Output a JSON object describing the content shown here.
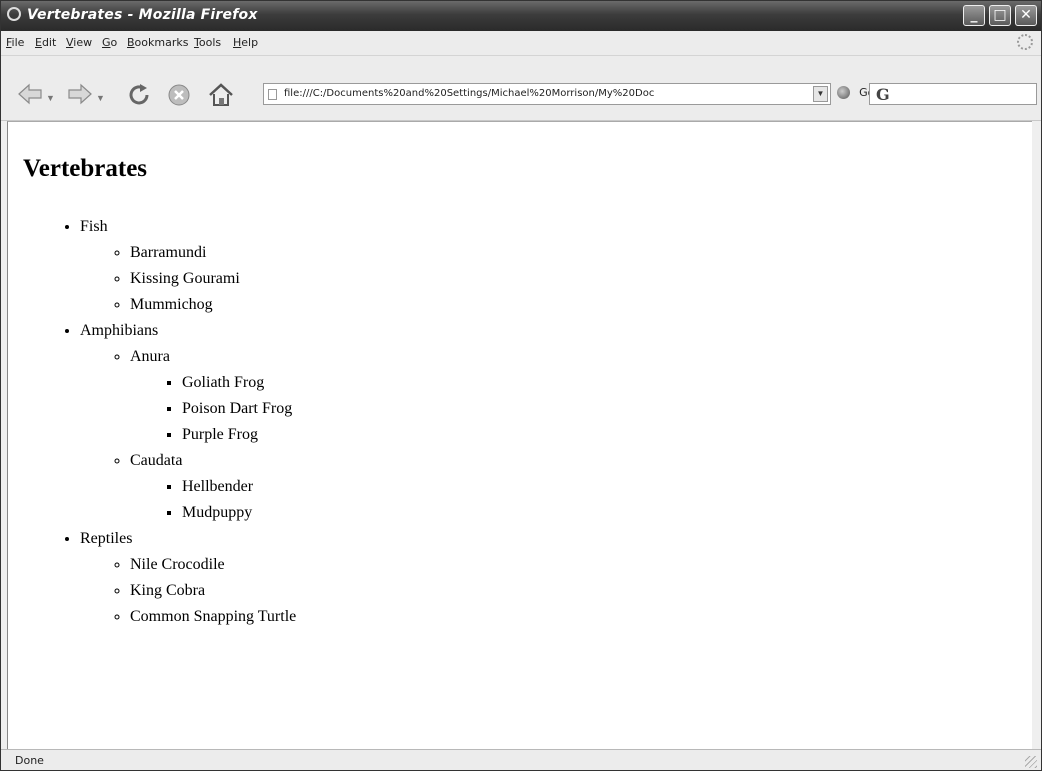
{
  "window": {
    "title": "Vertebrates - Mozilla Firefox",
    "controls": {
      "minimize": "_",
      "maximize": "□",
      "close": "✕"
    }
  },
  "menubar": {
    "items": [
      "File",
      "Edit",
      "View",
      "Go",
      "Bookmarks",
      "Tools",
      "Help"
    ]
  },
  "toolbar": {
    "back_icon": "back-arrow-icon",
    "forward_icon": "forward-arrow-icon",
    "reload_icon": "reload-icon",
    "stop_icon": "stop-icon",
    "home_icon": "home-icon",
    "url": "file:///C:/Documents%20and%20Settings/Michael%20Morrison/My%20Doc",
    "go_label": "Go",
    "search_engine": "G"
  },
  "page": {
    "heading": "Vertebrates",
    "fish": {
      "label": "Fish",
      "items": [
        "Barramundi",
        "Kissing Gourami",
        "Mummichog"
      ]
    },
    "amphibians": {
      "label": "Amphibians",
      "anura": {
        "label": "Anura",
        "items": [
          "Goliath Frog",
          "Poison Dart Frog",
          "Purple Frog"
        ]
      },
      "caudata": {
        "label": "Caudata",
        "items": [
          "Hellbender",
          "Mudpuppy"
        ]
      }
    },
    "reptiles": {
      "label": "Reptiles",
      "items": [
        "Nile Crocodile",
        "King Cobra",
        "Common Snapping Turtle"
      ]
    }
  },
  "status": {
    "text": "Done"
  },
  "colors": {
    "titlebar": "#3c3c3c",
    "chrome": "#ececec",
    "content_bg": "#ffffff"
  }
}
